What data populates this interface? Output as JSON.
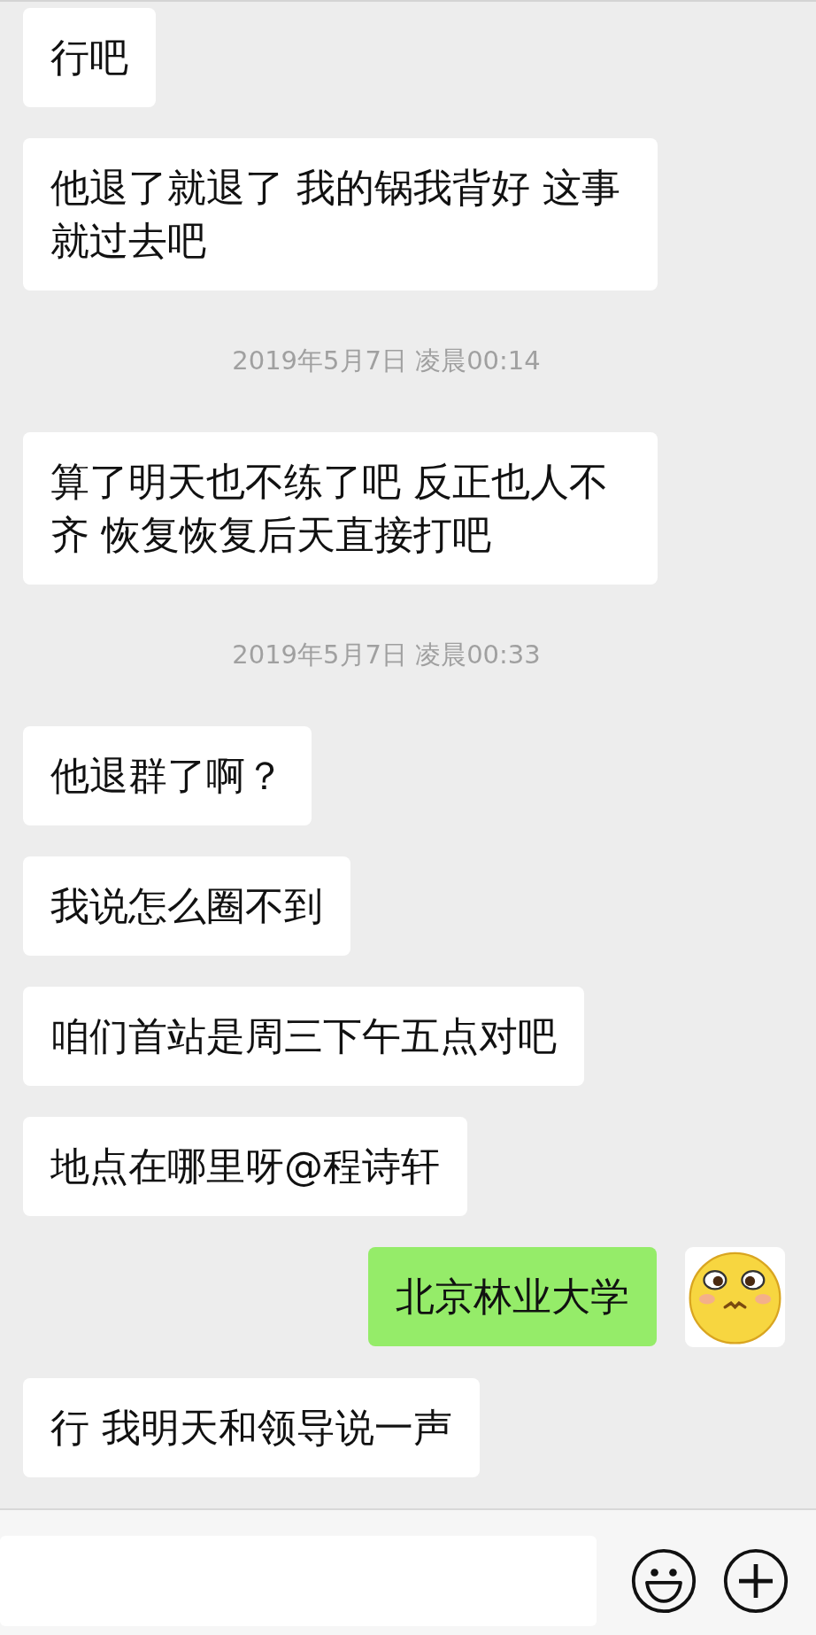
{
  "messages": [
    {
      "kind": "bubble",
      "outgoing": false,
      "text": "行吧"
    },
    {
      "kind": "bubble",
      "outgoing": false,
      "text": "他退了就退了 我的锅我背好 这事就过去吧"
    },
    {
      "kind": "timestamp",
      "text": "2019年5月7日 凌晨00:14"
    },
    {
      "kind": "bubble",
      "outgoing": false,
      "text": "算了明天也不练了吧 反正也人不齐 恢复恢复后天直接打吧"
    },
    {
      "kind": "timestamp",
      "text": "2019年5月7日 凌晨00:33"
    },
    {
      "kind": "bubble",
      "outgoing": false,
      "text": "他退群了啊？"
    },
    {
      "kind": "bubble",
      "outgoing": false,
      "text": "我说怎么圈不到"
    },
    {
      "kind": "bubble",
      "outgoing": false,
      "text": "咱们首站是周三下午五点对吧"
    },
    {
      "kind": "bubble",
      "outgoing": false,
      "text": "地点在哪里呀@程诗轩"
    },
    {
      "kind": "bubble",
      "outgoing": true,
      "text": "北京林业大学"
    },
    {
      "kind": "bubble",
      "outgoing": false,
      "text": "行 我明天和领导说一声"
    }
  ]
}
